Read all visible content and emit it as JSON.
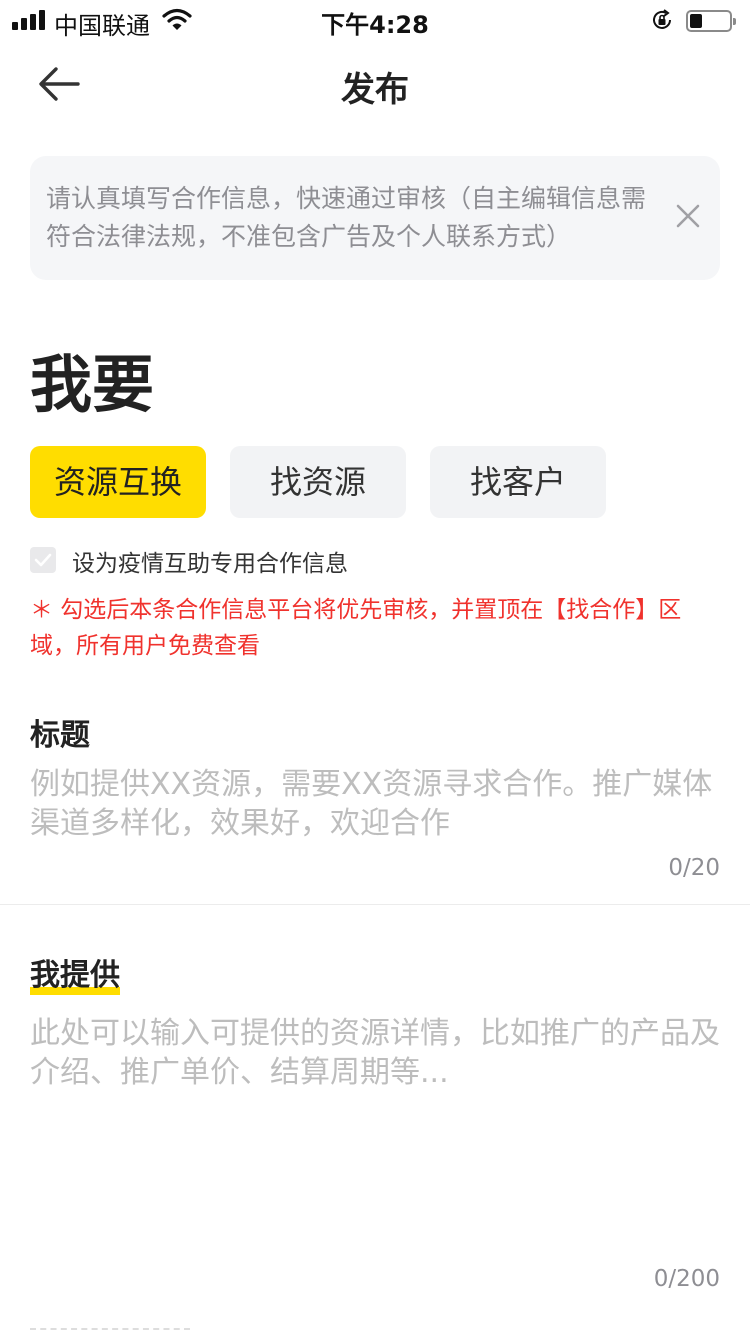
{
  "status_bar": {
    "carrier": "中国联通",
    "time": "下午4:28",
    "icons": [
      "signal-icon",
      "wifi-icon",
      "rotation-lock-icon",
      "battery-icon"
    ]
  },
  "nav": {
    "title": "发布",
    "back_icon": "arrow-left-icon"
  },
  "notice": {
    "text": "请认真填写合作信息，快速通过审核（自主编辑信息需符合法律法规，不准包含广告及个人联系方式）",
    "close_icon": "close-icon"
  },
  "section": {
    "title": "我要"
  },
  "types": [
    {
      "label": "资源互换",
      "selected": true
    },
    {
      "label": "找资源",
      "selected": false
    },
    {
      "label": "找客户",
      "selected": false
    }
  ],
  "epidemic": {
    "label": "设为疫情互助专用合作信息",
    "checked": false,
    "warning": "＊ 勾选后本条合作信息平台将优先审核，并置顶在【找合作】区域，所有用户免费查看"
  },
  "title_field": {
    "label": "标题",
    "placeholder": "例如提供XX资源，需要XX资源寻求合作。推广媒体渠道多样化，效果好，欢迎合作",
    "value": "",
    "counter": "0/20"
  },
  "provide_field": {
    "label": "我提供",
    "placeholder": "此处可以输入可提供的资源详情，比如推广的产品及介绍、推广单价、结算周期等...",
    "value": "",
    "counter": "0/200"
  },
  "colors": {
    "accent": "#ffdd00",
    "warning": "#f0322d",
    "notice_bg": "#f5f6f8",
    "placeholder": "#bdbdbd"
  }
}
